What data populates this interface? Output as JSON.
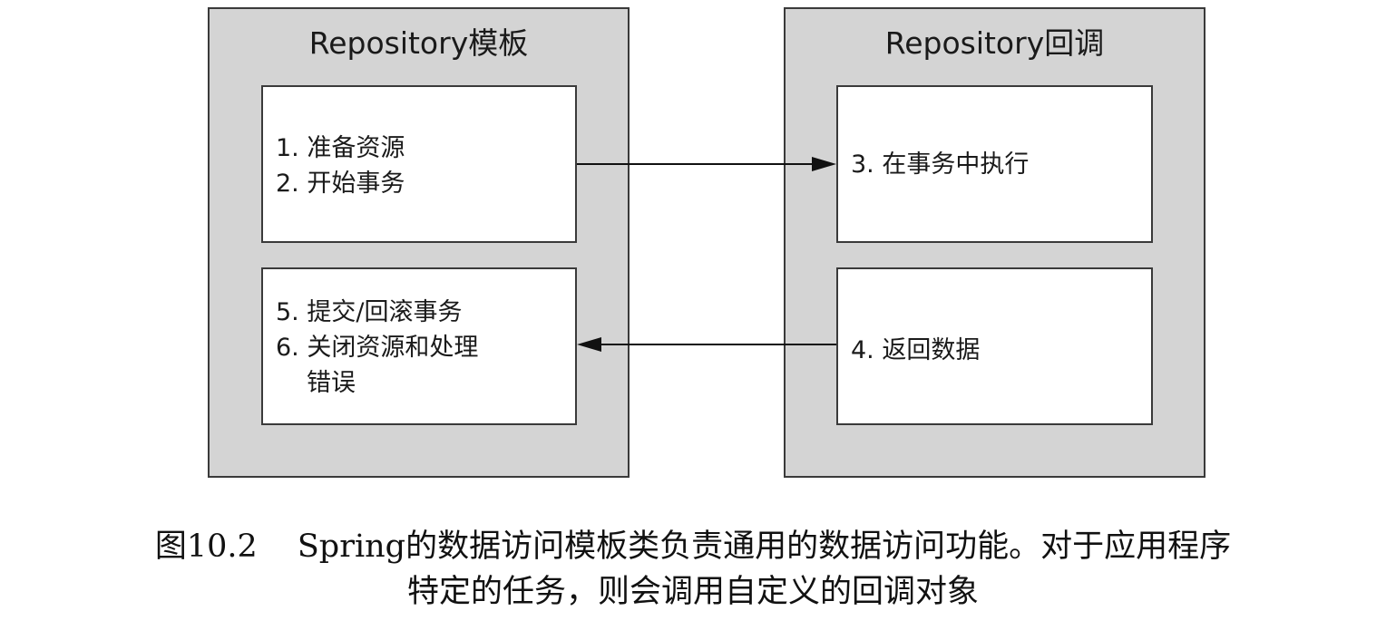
{
  "left_panel": {
    "title": "Repository模板",
    "top_box": {
      "lines": [
        "1. 准备资源",
        "2. 开始事务"
      ]
    },
    "bottom_box": {
      "lines": [
        "5. 提交/回滚事务",
        "6. 关闭资源和处理",
        "错误"
      ]
    }
  },
  "right_panel": {
    "title": "Repository回调",
    "top_box": {
      "lines": [
        "3. 在事务中执行"
      ]
    },
    "bottom_box": {
      "lines": [
        "4. 返回数据"
      ]
    }
  },
  "caption": {
    "figure_number": "图10.2",
    "line1": "Spring的数据访问模板类负责通用的数据访问功能。对于应用程序",
    "line2": "特定的任务，则会调用自定义的回调对象"
  },
  "colors": {
    "panel_fill": "#d4d4d4",
    "box_fill": "#ffffff",
    "border": "#3a3a3a"
  }
}
